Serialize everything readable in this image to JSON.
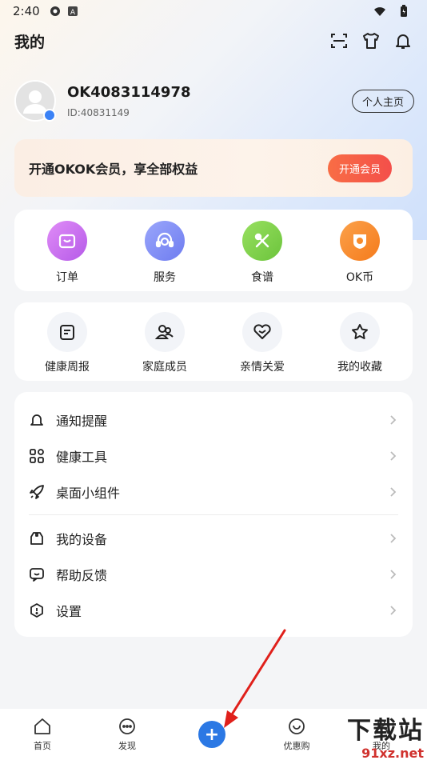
{
  "status_bar": {
    "time": "2:40"
  },
  "header": {
    "title": "我的"
  },
  "profile": {
    "name": "OK4083114978",
    "uid": "ID:40831149",
    "home_button": "个人主页"
  },
  "vip": {
    "text": "开通OKOK会员，享全部权益",
    "button": "开通会员"
  },
  "shortcuts": [
    {
      "label": "订单",
      "icon": "order-icon",
      "color": "#c86ef0"
    },
    {
      "label": "服务",
      "icon": "service-headset-icon",
      "color": "#7f8df5"
    },
    {
      "label": "食谱",
      "icon": "recipe-icon",
      "color": "#7ed14a"
    },
    {
      "label": "OK币",
      "icon": "ok-coin-icon",
      "color": "#f88c2c"
    }
  ],
  "tools": [
    {
      "label": "健康周报",
      "icon": "health-report-icon"
    },
    {
      "label": "家庭成员",
      "icon": "family-members-icon"
    },
    {
      "label": "亲情关爱",
      "icon": "family-care-icon"
    },
    {
      "label": "我的收藏",
      "icon": "favorites-icon"
    }
  ],
  "menu_group1": [
    {
      "label": "通知提醒",
      "icon": "bell-icon"
    },
    {
      "label": "健康工具",
      "icon": "grid-tools-icon"
    },
    {
      "label": "桌面小组件",
      "icon": "rocket-icon"
    }
  ],
  "menu_group2": [
    {
      "label": "我的设备",
      "icon": "device-icon"
    },
    {
      "label": "帮助反馈",
      "icon": "feedback-icon"
    },
    {
      "label": "设置",
      "icon": "settings-icon"
    }
  ],
  "tabs": [
    {
      "label": "首页",
      "icon": "home-icon"
    },
    {
      "label": "发现",
      "icon": "discover-icon"
    },
    {
      "label": "",
      "icon": "add-icon"
    },
    {
      "label": "优惠购",
      "icon": "shop-icon"
    },
    {
      "label": "我的",
      "icon": "profile-icon"
    }
  ],
  "watermark": {
    "line1": "下载站",
    "line2": "91xz.net"
  },
  "colors": {
    "accent": "#2b78e4",
    "vip_button": "#f4594a",
    "arrow": "#e0201b"
  }
}
